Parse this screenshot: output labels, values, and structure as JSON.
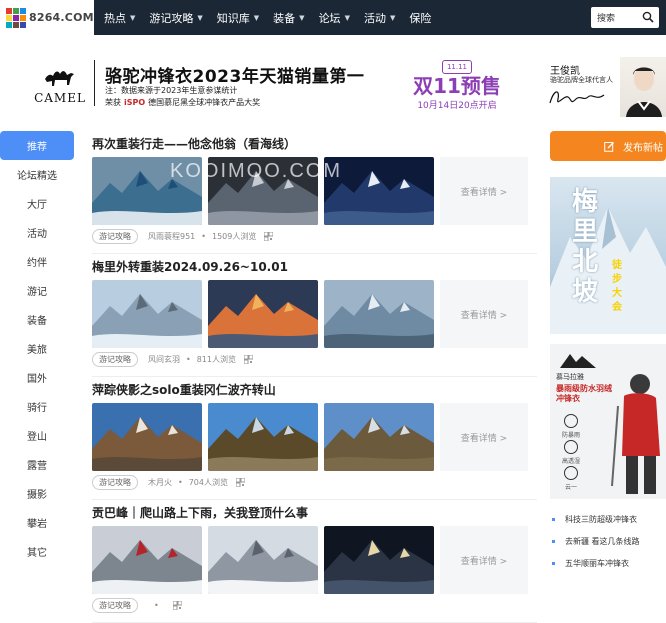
{
  "site": {
    "logo_text": "8264.COM",
    "logo_colors": [
      "#e53935",
      "#43a047",
      "#1e88e5",
      "#fdd835",
      "#8e24aa",
      "#fb8c00",
      "#00acc1",
      "#6d4c41",
      "#3949ab"
    ]
  },
  "nav": {
    "items": [
      {
        "label": "热点",
        "dropdown": true
      },
      {
        "label": "游记攻略",
        "dropdown": true
      },
      {
        "label": "知识库",
        "dropdown": true
      },
      {
        "label": "装备",
        "dropdown": true
      },
      {
        "label": "论坛",
        "dropdown": true
      },
      {
        "label": "活动",
        "dropdown": true
      },
      {
        "label": "保险",
        "dropdown": false
      }
    ],
    "caret": "▼",
    "search_placeholder": "搜索"
  },
  "banner": {
    "brand": "CAMEL",
    "title": "骆驼冲锋衣2023年天猫销量第一",
    "note": "注：数据来源于2023年生意参谋统计",
    "award_prefix": "荣获",
    "award_iso": "iSPO",
    "award_suffix": "德国慕尼黑全球冲锋衣产品大奖",
    "promo_icon": "11.11",
    "promo_title": "双11预售",
    "promo_sub": "10月14日20点开启",
    "celeb_name": "王俊凯",
    "celeb_role": "骆驼品牌全球代言人"
  },
  "sidebar": {
    "items": [
      "推荐",
      "论坛精选",
      "大厅",
      "活动",
      "约伴",
      "游记",
      "装备",
      "美旅",
      "国外",
      "骑行",
      "登山",
      "露营",
      "摄影",
      "攀岩",
      "其它"
    ],
    "active_index": 0
  },
  "feed": {
    "more_label": "查看详情 >",
    "watermark": "KOOIMOO.COM",
    "posts": [
      {
        "title": "再次重装行走——他念他翁（看海线）",
        "tag": "游记攻略",
        "author": "风雨蓑程951",
        "views": "1509人浏览"
      },
      {
        "title": "梅里外转重装2024.09.26~10.01",
        "tag": "游记攻略",
        "author": "风间玄羽",
        "views": "811人浏览"
      },
      {
        "title": "萍踪侠影之solo重装冈仁波齐转山",
        "tag": "游记攻略",
        "author": "木月火",
        "views": "704人浏览"
      },
      {
        "title": "贡巴峰｜爬山路上下雨，关我登顶什么事",
        "tag": "游记攻略",
        "author": "",
        "views": ""
      }
    ]
  },
  "right": {
    "publish_label": "发布新帖",
    "ad1_vertical": "梅里北坡",
    "ad1_sub": "徒步大会",
    "ad2_brand": "慕马拉雅",
    "ad2_title": "暴雨级防水羽绒冲锋衣",
    "ad2_features": [
      "防暴雨",
      "高透湿",
      "云一"
    ],
    "news": [
      "科技三防超级冲锋衣",
      "去新疆 看这几条线路",
      "五华顺丽车冲锋衣"
    ]
  }
}
